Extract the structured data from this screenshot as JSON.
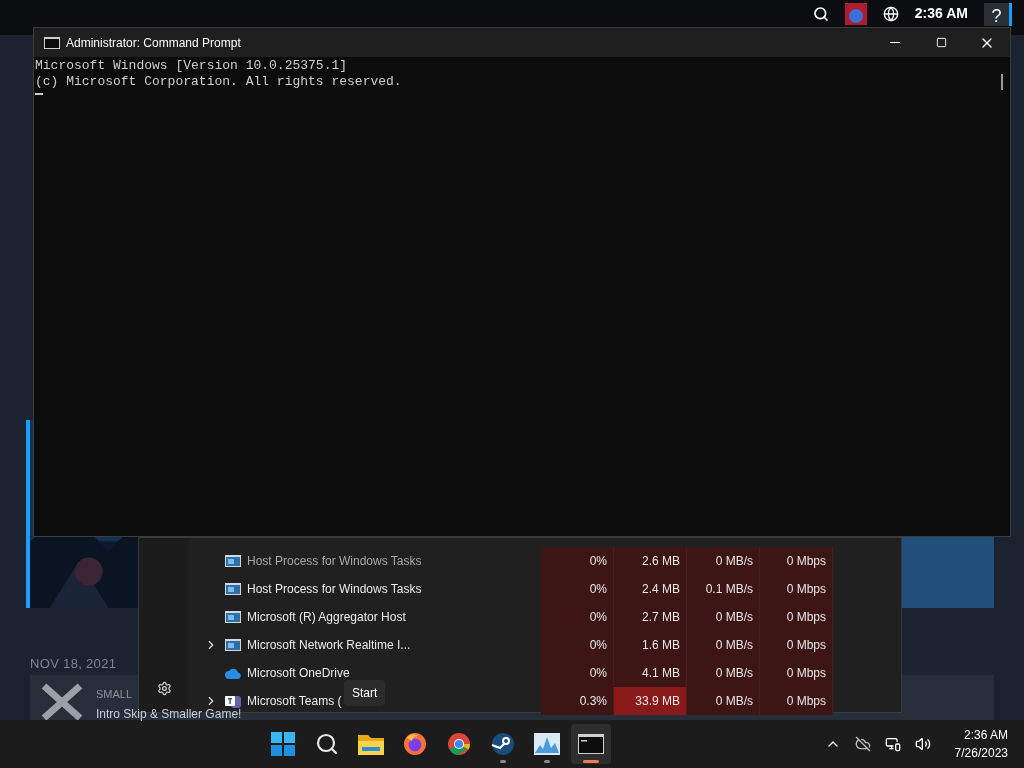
{
  "top_bar": {
    "time": "2:36 AM",
    "help": "?"
  },
  "news": {
    "date": "NOV 18, 2021",
    "tag": "SMALL",
    "title": "Intro Skip & Smaller Game!"
  },
  "task_manager": {
    "rows": [
      {
        "name": "Host Process for Windows Tasks",
        "kind": "app",
        "expandable": false,
        "dimmed": true,
        "cpu": "0%",
        "memory": "2.6 MB",
        "memory_hot": false,
        "disk": "0 MB/s",
        "network": "0 Mbps"
      },
      {
        "name": "Host Process for Windows Tasks",
        "kind": "app",
        "expandable": false,
        "dimmed": false,
        "cpu": "0%",
        "memory": "2.4 MB",
        "memory_hot": false,
        "disk": "0.1 MB/s",
        "network": "0 Mbps"
      },
      {
        "name": "Microsoft (R) Aggregator Host",
        "kind": "app",
        "expandable": false,
        "dimmed": false,
        "cpu": "0%",
        "memory": "2.7 MB",
        "memory_hot": false,
        "disk": "0 MB/s",
        "network": "0 Mbps"
      },
      {
        "name": "Microsoft Network Realtime I...",
        "kind": "app",
        "expandable": true,
        "dimmed": false,
        "cpu": "0%",
        "memory": "1.6 MB",
        "memory_hot": false,
        "disk": "0 MB/s",
        "network": "0 Mbps"
      },
      {
        "name": "Microsoft OneDrive",
        "kind": "cloud",
        "expandable": false,
        "dimmed": false,
        "cpu": "0%",
        "memory": "4.1 MB",
        "memory_hot": false,
        "disk": "0 MB/s",
        "network": "0 Mbps"
      },
      {
        "name": "Microsoft Teams (",
        "kind": "teams",
        "expandable": true,
        "dimmed": false,
        "cpu": "0.3%",
        "memory": "33.9 MB",
        "memory_hot": true,
        "disk": "0 MB/s",
        "network": "0 Mbps"
      }
    ],
    "tooltip": "Start"
  },
  "cmd": {
    "title": "Administrator: Command Prompt",
    "lines": [
      "Microsoft Windows [Version 10.0.25375.1]",
      "(c) Microsoft Corporation. All rights reserved."
    ]
  },
  "taskbar": {
    "apps": [
      {
        "kind": "start",
        "running": false,
        "active": false
      },
      {
        "kind": "search",
        "running": false,
        "active": false
      },
      {
        "kind": "folder",
        "running": false,
        "active": false
      },
      {
        "kind": "firefox",
        "running": false,
        "active": false
      },
      {
        "kind": "chrome",
        "running": false,
        "active": false
      },
      {
        "kind": "steam",
        "running": true,
        "active": false
      },
      {
        "kind": "monitor",
        "running": true,
        "active": false
      },
      {
        "kind": "terminal",
        "running": true,
        "active": true
      }
    ],
    "time": "2:36 AM",
    "date": "7/26/2023"
  }
}
